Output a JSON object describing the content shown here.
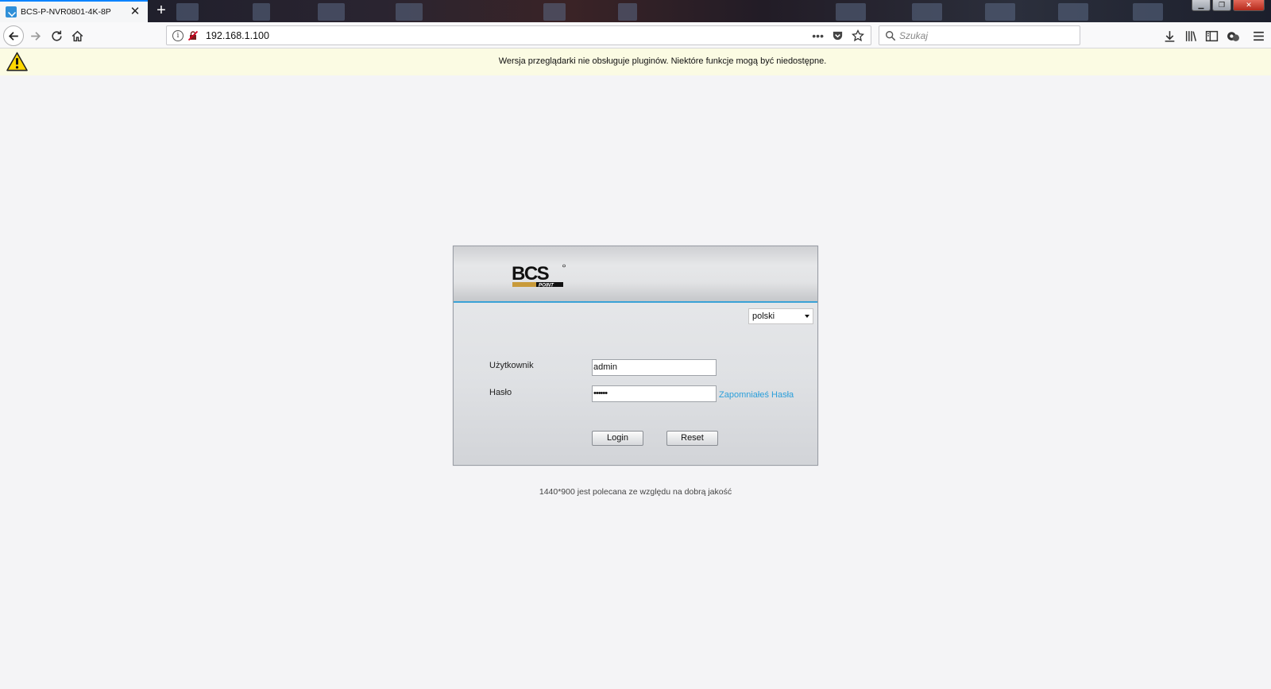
{
  "browser": {
    "tab_title": "BCS-P-NVR0801-4K-8P",
    "tab_close": "✕",
    "new_tab": "+",
    "url": "192.168.1.100",
    "search_placeholder": "Szukaj",
    "accent_color": "#0a84ff"
  },
  "notification": {
    "text": "Wersja przeglądarki nie obsługuje pluginów. Niektóre funkcje mogą być niedostępne.",
    "icon": "warning-icon"
  },
  "login": {
    "language": "polski",
    "username_label": "Użytkownik",
    "username_value": "admin",
    "password_label": "Hasło",
    "password_value": "••••••",
    "forgot_link": "Zapomniałeś Hasła",
    "login_button": "Login",
    "reset_button": "Reset",
    "accent_color": "#3aa2d6"
  },
  "footer": {
    "note": "1440*900 jest polecana ze względu na dobrą jakość"
  }
}
